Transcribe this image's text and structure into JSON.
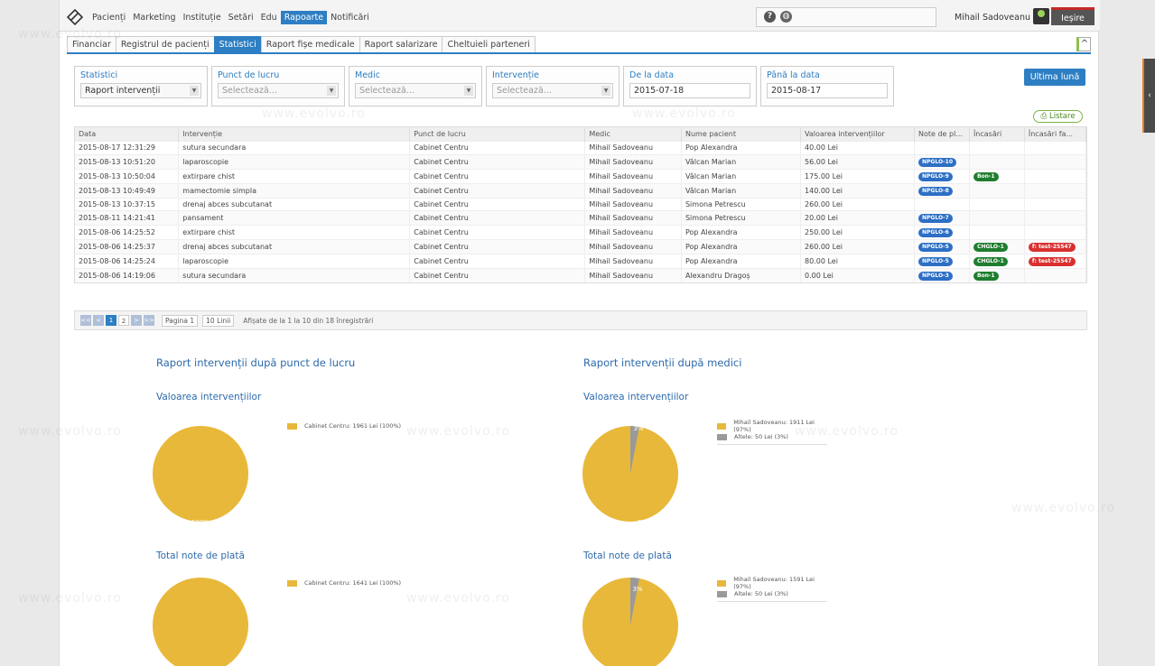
{
  "nav": {
    "menu": [
      "Pacienți",
      "Marketing",
      "Instituție",
      "Setări",
      "Edu",
      "Rapoarte",
      "Notificări"
    ],
    "active": "Rapoarte",
    "help_icon": "?",
    "globe_icon": "globe-icon",
    "user": "Mihail Sadoveanu",
    "logout": "Ieșire"
  },
  "tabs": [
    "Financiar",
    "Registrul de pacienți",
    "Statistici",
    "Raport fișe medicale",
    "Raport salarizare",
    "Cheltuieli parteneri"
  ],
  "active_tab": "Statistici",
  "filters": [
    {
      "label": "Statistici",
      "value": "Raport intervenții",
      "placeholder": false
    },
    {
      "label": "Punct de lucru",
      "value": "Selectează...",
      "placeholder": true
    },
    {
      "label": "Medic",
      "value": "Selectează...",
      "placeholder": true
    },
    {
      "label": "Intervenție",
      "value": "Selectează...",
      "placeholder": true
    },
    {
      "label": "De la data",
      "value": "2015-07-18",
      "placeholder": false
    },
    {
      "label": "Până la data",
      "value": "2015-08-17",
      "placeholder": false
    }
  ],
  "btn_last": "Ultima lună",
  "btn_list": "Listare",
  "table": {
    "headers": [
      "Data",
      "Intervenție",
      "Punct de lucru",
      "Medic",
      "Nume pacient",
      "Valoarea intervențiilor",
      "Note de pl...",
      "Încasări",
      "Încasări fa..."
    ],
    "rows": [
      [
        "2015-08-17 12:31:29",
        "sutura secundara",
        "Cabinet Centru",
        "Mihail Sadoveanu",
        "Pop Alexandra",
        "40.00 Lei",
        "",
        "",
        ""
      ],
      [
        "2015-08-13 10:51:20",
        "laparoscopie",
        "Cabinet Centru",
        "Mihail Sadoveanu",
        "Vâlcan Marian",
        "56.00 Lei",
        "NPGLO-10",
        "",
        ""
      ],
      [
        "2015-08-13 10:50:04",
        "extirpare chist",
        "Cabinet Centru",
        "Mihail Sadoveanu",
        "Vâlcan Marian",
        "175.00 Lei",
        "NPGLO-9",
        "Bon-1",
        ""
      ],
      [
        "2015-08-13 10:49:49",
        "mamectomie simpla",
        "Cabinet Centru",
        "Mihail Sadoveanu",
        "Vâlcan Marian",
        "140.00 Lei",
        "NPGLO-8",
        "",
        ""
      ],
      [
        "2015-08-13 10:37:15",
        "drenaj abces subcutanat",
        "Cabinet Centru",
        "Mihail Sadoveanu",
        "Simona Petrescu",
        "260.00 Lei",
        "",
        "",
        ""
      ],
      [
        "2015-08-11 14:21:41",
        "pansament",
        "Cabinet Centru",
        "Mihail Sadoveanu",
        "Simona Petrescu",
        "20.00 Lei",
        "NPGLO-7",
        "",
        ""
      ],
      [
        "2015-08-06 14:25:52",
        "extirpare chist",
        "Cabinet Centru",
        "Mihail Sadoveanu",
        "Pop Alexandra",
        "250.00 Lei",
        "NPGLO-6",
        "",
        ""
      ],
      [
        "2015-08-06 14:25:37",
        "drenaj abces subcutanat",
        "Cabinet Centru",
        "Mihail Sadoveanu",
        "Pop Alexandra",
        "260.00 Lei",
        "NPGLO-5",
        "CHGLO-1",
        "f: test-25547"
      ],
      [
        "2015-08-06 14:25:24",
        "laparoscopie",
        "Cabinet Centru",
        "Mihail Sadoveanu",
        "Pop Alexandra",
        "80.00 Lei",
        "NPGLO-5",
        "CHGLO-1",
        "f: test-25547"
      ],
      [
        "2015-08-06 14:19:06",
        "sutura secundara",
        "Cabinet Centru",
        "Mihail Sadoveanu",
        "Alexandru Dragoș",
        "0.00 Lei",
        "NPGLO-3",
        "Bon-1",
        ""
      ]
    ]
  },
  "pager": {
    "buttons": [
      "<<",
      "<",
      "1",
      "2",
      ">",
      ">>"
    ],
    "page": "Pagina 1",
    "lines": "10 Linii",
    "info": "Afișate de la 1 la 10 din 18 înregistrări"
  },
  "reports": {
    "left_title": "Raport intervenții după punct de lucru",
    "right_title": "Raport intervenții după medici",
    "sub_value": "Valoarea intervențiilor",
    "sub_notes": "Total note de plată",
    "left_value_legend": [
      "Cabinet Centru: 1961 Lei (100%)"
    ],
    "left_value_label": "100%",
    "right_value_legend": [
      "Mihail Sadoveanu: 1911 Lei (97%)",
      "Altele: 50 Lei (3%)"
    ],
    "right_value_labels": [
      "3%",
      "97%"
    ],
    "left_notes_legend": [
      "Cabinet Centru: 1641 Lei (100%)"
    ],
    "right_notes_legend": [
      "Mihail Sadoveanu: 1591 Lei (97%)",
      "Altele: 50 Lei (3%)"
    ],
    "right_notes_labels": [
      "3%"
    ]
  },
  "colors": {
    "accent": "#2d7ec3",
    "pie_main": "#e8b83a",
    "pie_other": "#9a9a9a"
  },
  "watermark": "www.evolvo.ro"
}
